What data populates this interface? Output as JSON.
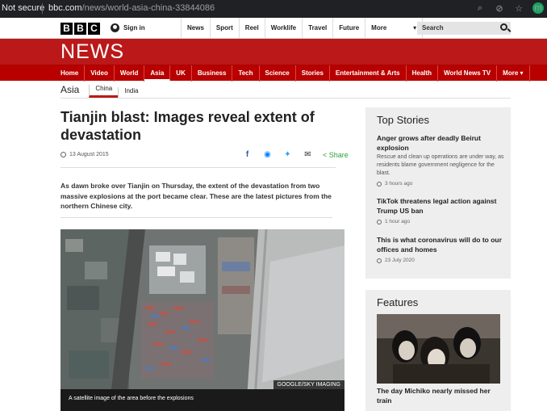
{
  "browser": {
    "security": "Not secure",
    "url_host": "bbc.com",
    "url_path": "/news/world-asia-china-33844086",
    "profile_initial": "m"
  },
  "topbar": {
    "logo_letters": [
      "B",
      "B",
      "C"
    ],
    "signin_label": "Sign in",
    "nav": [
      "News",
      "Sport",
      "Reel",
      "Worklife",
      "Travel",
      "Future"
    ],
    "more_label": "More",
    "search_placeholder": "Search"
  },
  "newsband": {
    "title": "NEWS"
  },
  "rednav": {
    "items": [
      "Home",
      "Video",
      "World",
      "Asia",
      "UK",
      "Business",
      "Tech",
      "Science",
      "Stories",
      "Entertainment & Arts",
      "Health",
      "World News TV",
      "More ▾"
    ],
    "active": "Asia"
  },
  "subnav": {
    "section": "Asia",
    "items": [
      "China",
      "India"
    ],
    "active": "China"
  },
  "article": {
    "headline": "Tianjin blast: Images reveal extent of devastation",
    "date": "13 August 2015",
    "share_label": "Share",
    "intro": "As dawn broke over Tianjin on Thursday, the extent of the devastation from two massive explosions at the port became clear. These are the latest pictures from the northern Chinese city.",
    "image_credit": "GOOGLE/SKY IMAGING",
    "image_caption": "A satellite image of the area before the explosions"
  },
  "top_stories": {
    "title": "Top Stories",
    "items": [
      {
        "title": "Anger grows after deadly Beirut explosion",
        "summary": "Rescue and clean up operations are under way, as residents blame government negligence for the blast.",
        "time": "3 hours ago"
      },
      {
        "title": "TikTok threatens legal action against Trump US ban",
        "summary": "",
        "time": "1 hour ago"
      },
      {
        "title": "This is what coronavirus will do to our offices and homes",
        "summary": "",
        "time": "23 July 2020"
      }
    ]
  },
  "features": {
    "title": "Features",
    "item_title": "The day Michiko nearly missed her train"
  },
  "colors": {
    "bbc_red": "#bb1919",
    "nav_red": "#b80000",
    "panel_gray": "#eeeeee"
  }
}
